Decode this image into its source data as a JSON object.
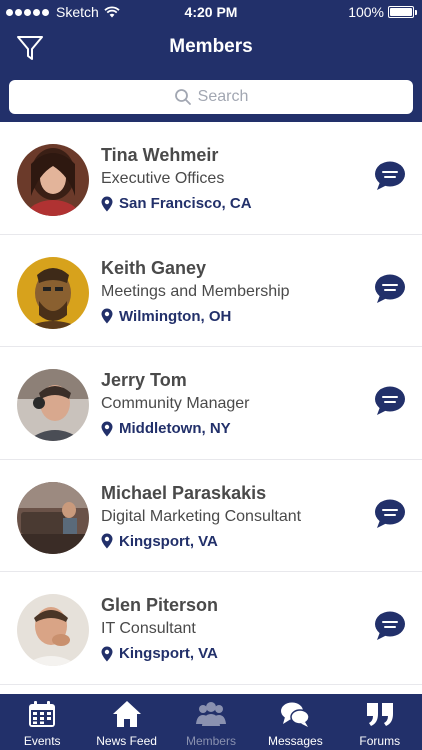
{
  "status_bar": {
    "carrier": "Sketch",
    "time": "4:20 PM",
    "battery": "100%"
  },
  "header": {
    "title": "Members",
    "filter_icon": "filter-funnel-icon"
  },
  "search": {
    "placeholder": "Search",
    "icon": "search-icon"
  },
  "members": [
    {
      "name": "Tina Wehmeir",
      "role": "Executive Offices",
      "location": "San Francisco, CA"
    },
    {
      "name": "Keith Ganey",
      "role": "Meetings and Membership",
      "location": "Wilmington, OH"
    },
    {
      "name": "Jerry Tom",
      "role": "Community Manager",
      "location": "Middletown, NY"
    },
    {
      "name": "Michael Paraskakis",
      "role": "Digital Marketing Consultant",
      "location": "Kingsport, VA"
    },
    {
      "name": "Glen Piterson",
      "role": "IT Consultant",
      "location": "Kingsport, VA"
    }
  ],
  "tabs": [
    {
      "label": "Events",
      "icon": "calendar-icon",
      "active": false
    },
    {
      "label": "News Feed",
      "icon": "home-icon",
      "active": false
    },
    {
      "label": "Members",
      "icon": "members-icon",
      "active": true
    },
    {
      "label": "Messages",
      "icon": "chat-bubbles-icon",
      "active": false
    },
    {
      "label": "Forums",
      "icon": "quote-icon",
      "active": false
    }
  ],
  "colors": {
    "brand": "#22306a",
    "text": "#4a4a4a",
    "inactive_tab": "#8a91b0",
    "divider": "#e8e8ec"
  }
}
